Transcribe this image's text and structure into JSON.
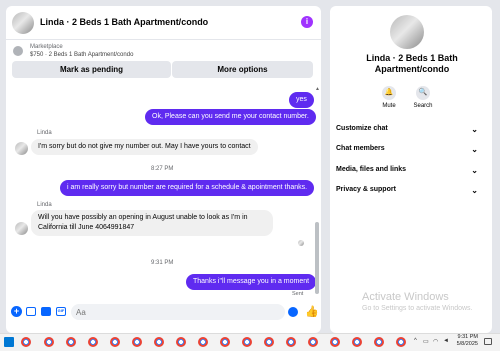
{
  "header": {
    "title": "Linda · 2 Beds 1 Bath Apartment/condo",
    "info_icon": "i"
  },
  "marketplace": {
    "label": "Marketplace",
    "listing": "$750 · 2 Beds 1 Bath Apartment/condo"
  },
  "actions": {
    "pending": "Mark as pending",
    "more": "More options"
  },
  "thread": {
    "m1": "yes",
    "m2": "Ok, Please can you send me your contact number.",
    "sender1": "Linda",
    "m3": "I'm sorry but do not give my number out. May I have yours to contact",
    "t1": "8:27 PM",
    "m4": "i am really sorry but number are required for a schedule & apointment thanks.",
    "sender2": "Linda",
    "m5a": "Will you have possibly an opening in August unable to look as I'm in",
    "m5b": "California till June 4064991847",
    "t2": "9:31 PM",
    "m6": "Thanks i\"ll message you in a moment",
    "status": "Sent"
  },
  "composer": {
    "placeholder": "Aa"
  },
  "info": {
    "title_line1": "Linda · 2 Beds 1 Bath",
    "title_line2": "Apartment/condo",
    "mute": "Mute",
    "search": "Search",
    "sections": [
      "Customize chat",
      "Chat members",
      "Media, files and links",
      "Privacy & support"
    ]
  },
  "watermark": {
    "line1": "Activate Windows",
    "line2": "Go to Settings to activate Windows."
  },
  "taskbar": {
    "time": "9:31 PM",
    "date": "5/8/2025"
  },
  "colors": {
    "accent": "#5f2bf0",
    "info_icon": "#a033ff",
    "icon_blue": "#0866ff"
  }
}
